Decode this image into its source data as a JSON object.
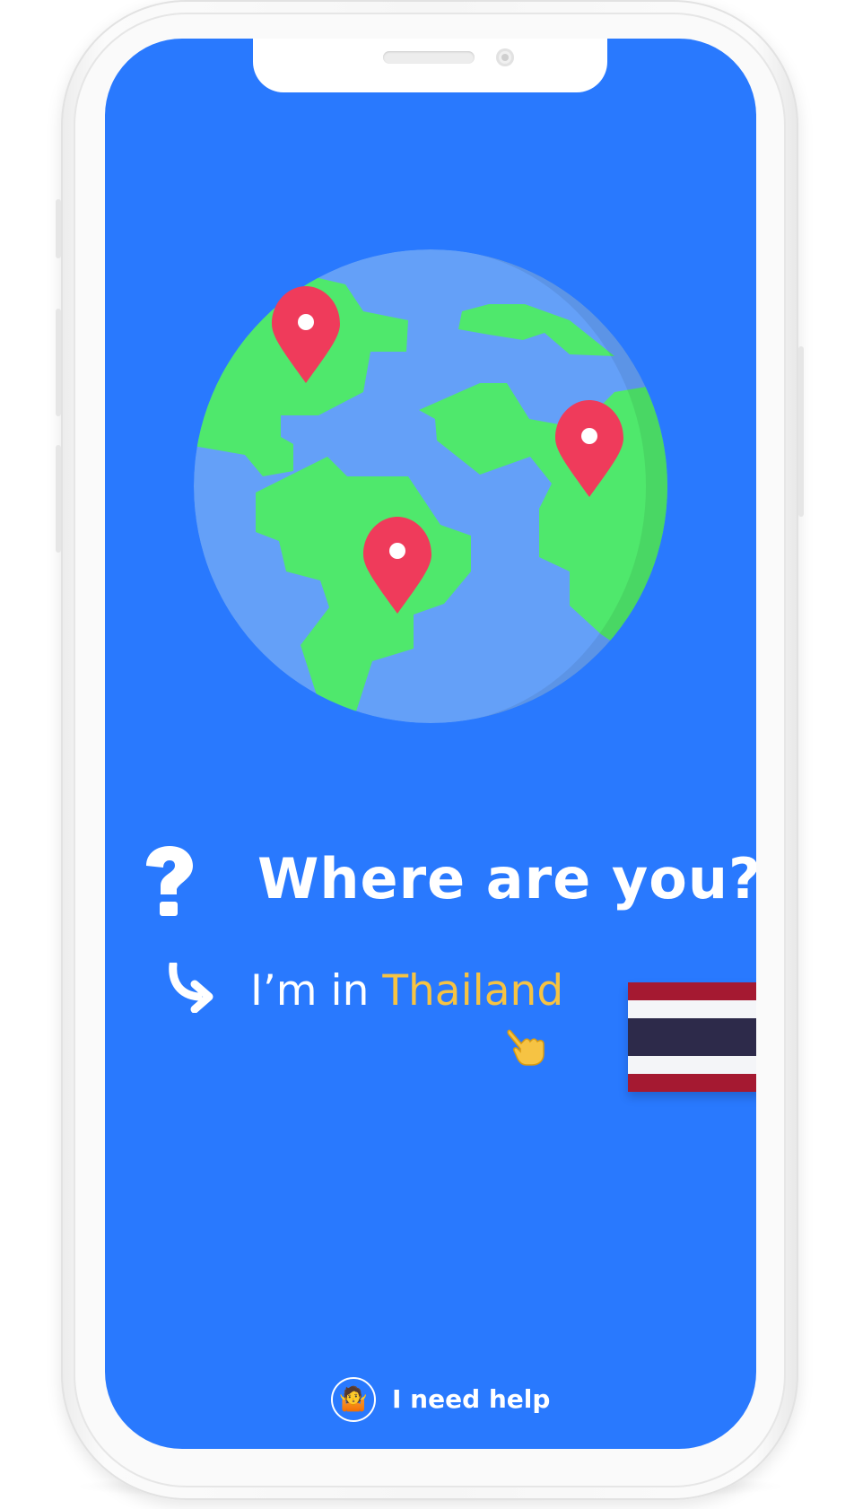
{
  "screen": {
    "background": "#2979fe",
    "title": "Where are you?",
    "answer_prefix": "I’m in ",
    "answer_country": "Thailand",
    "help_label": "I need help",
    "help_icon": "person-shrugging-emoji",
    "icons": {
      "title_icon": "question-mark-icon",
      "answer_icon": "curved-arrow-icon",
      "tap_icon": "pointing-hand-icon",
      "flag": "thailand-flag"
    }
  },
  "colors": {
    "accent": "#f6c343",
    "land": "#4fe86c",
    "ocean": "#64a0f8",
    "pin": "#ef3b5b",
    "flag_red": "#a51931",
    "flag_white": "#f4f5f8",
    "flag_blue": "#2d2a4a"
  }
}
